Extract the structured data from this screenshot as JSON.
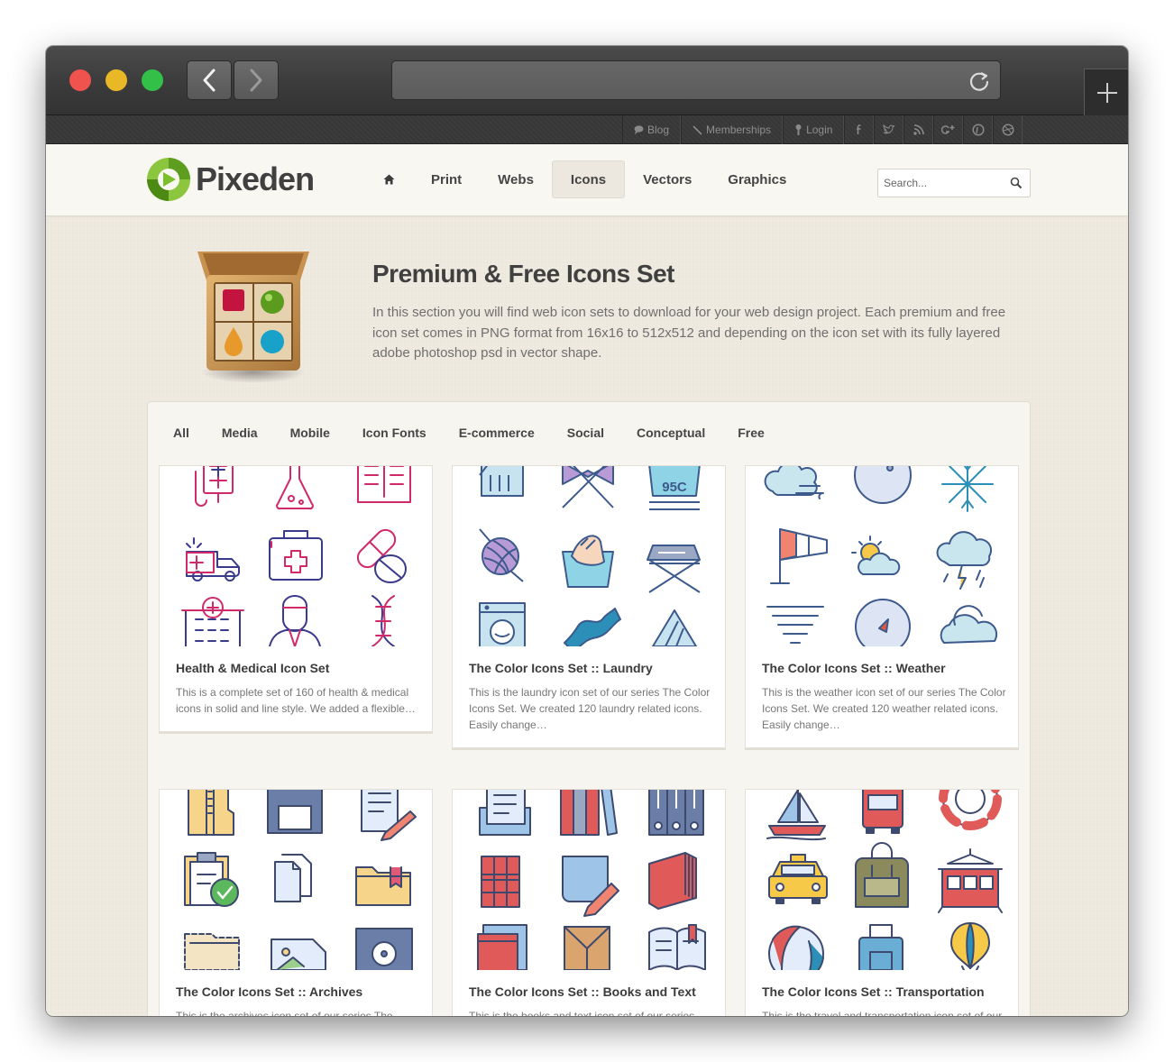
{
  "browser": {
    "back_label": "Back",
    "forward_label": "Forward",
    "new_tab_label": "New tab"
  },
  "toplinks": [
    {
      "label": "Blog",
      "icon": "chat-bubble-icon"
    },
    {
      "label": "Memberships",
      "icon": "pencil-icon"
    },
    {
      "label": "Login",
      "icon": "key-icon"
    }
  ],
  "social": [
    "facebook-icon",
    "twitter-icon",
    "rss-icon",
    "google-plus-icon",
    "pinterest-icon",
    "dribbble-icon"
  ],
  "site": {
    "logo_text": "Pixeden",
    "nav": [
      "Print",
      "Webs",
      "Icons",
      "Vectors",
      "Graphics"
    ],
    "active_nav": "Icons",
    "search_placeholder": "Search..."
  },
  "hero": {
    "title": "Premium & Free Icons Set",
    "description": "In this section you will find web icon sets to download for your web design project. Each premium and free icon set comes in PNG format from 16x16 to 512x512 and depending on the icon set with its fully layered adobe photoshop psd in vector shape."
  },
  "filters": [
    "All",
    "Media",
    "Mobile",
    "Icon Fonts",
    "E-commerce",
    "Social",
    "Conceptual",
    "Free"
  ],
  "cards": [
    {
      "title": "Health & Medical Icon Set",
      "desc": "This is a complete set of 160 of health & medical icons in solid and line style. We added a flexible…"
    },
    {
      "title": "The Color Icons Set :: Laundry",
      "desc": "This is the laundry icon set of our series The Color Icons Set. We created 120 laundry related icons. Easily change…"
    },
    {
      "title": "The Color Icons Set :: Weather",
      "desc": "This is the weather icon set of our series The Color Icons Set. We created 120 weather related icons. Easily change…"
    },
    {
      "title": "The Color Icons Set :: Archives",
      "desc": "This is the archives icon set of our series The Color Icons Set."
    },
    {
      "title": "The Color Icons Set :: Books and Text",
      "desc": "This is the books and text icon set of our series The Color Icons Set."
    },
    {
      "title": "The Color Icons Set :: Transportation",
      "desc": "This is the travel and transportation icon set of our series The Color Icons Set."
    }
  ],
  "laundry_temp_label": "95C",
  "colors": {
    "accent_green": "#7bbf2a",
    "medical_pink": "#d12a6a",
    "medical_navy": "#3a3a8c",
    "text_dark": "#404040"
  }
}
